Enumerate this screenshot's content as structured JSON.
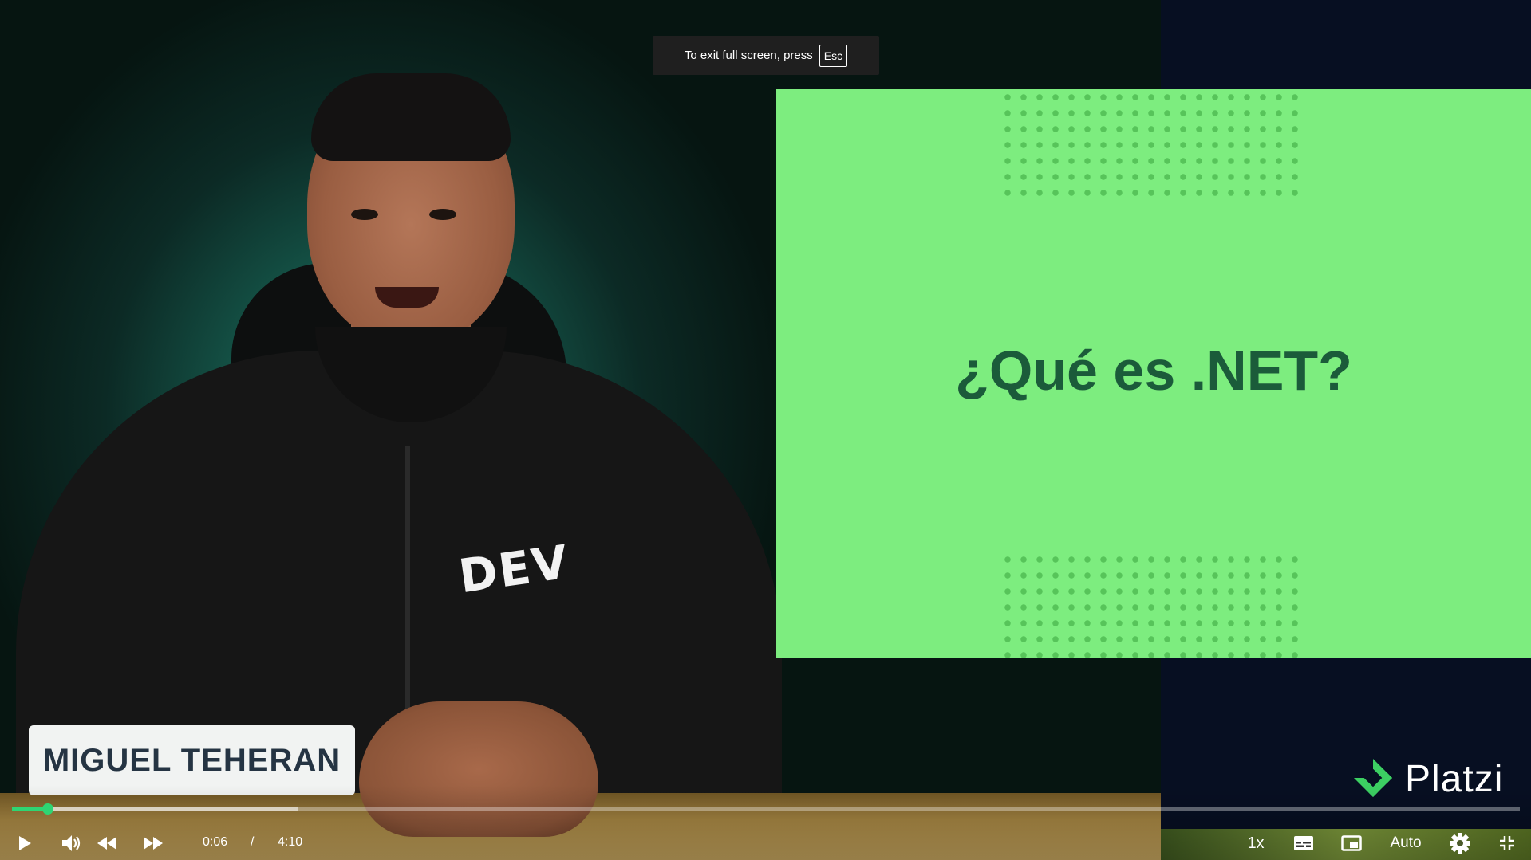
{
  "video": {
    "slide_title": "¿Qué es .NET?",
    "lower_third_name": "MIGUEL TEHERAN",
    "shirt_text": "DEV",
    "brand_name": "Platzi",
    "slide_color": "#7ded7f",
    "slide_text_color": "#1b5b3a",
    "brand_color": "#3ccf62"
  },
  "fullscreen_toast": {
    "message": "To exit full screen, press",
    "key_label": "Esc"
  },
  "player": {
    "accent_color": "#2ed573",
    "progress_fraction": 0.024,
    "buffered_fraction": 0.19,
    "current_time": "0:06",
    "time_separator": "/",
    "duration": "4:10",
    "playback_speed": "1x",
    "quality": "Auto",
    "icons": {
      "play": "play-icon",
      "volume": "volume-icon",
      "rewind": "rewind-icon",
      "forward": "fast-forward-icon",
      "captions": "captions-icon",
      "pip": "picture-in-picture-icon",
      "settings": "gear-icon",
      "exit_fullscreen": "exit-fullscreen-icon"
    }
  }
}
